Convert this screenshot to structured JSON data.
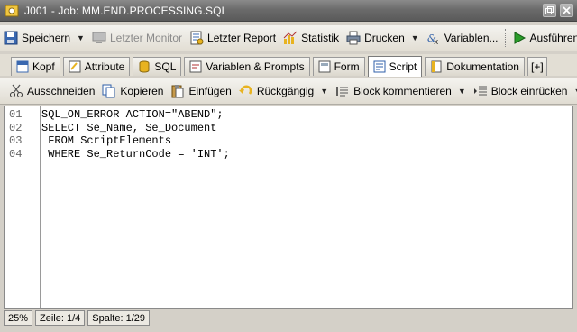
{
  "window": {
    "title": "J001 - Job: MM.END.PROCESSING.SQL"
  },
  "toolbar": {
    "speichern": "Speichern",
    "letzter_monitor": "Letzter Monitor",
    "letzter_report": "Letzter Report",
    "statistik": "Statistik",
    "drucken": "Drucken",
    "variablen": "Variablen...",
    "ausfuehren": "Ausführen"
  },
  "tabs": [
    {
      "label": "Kopf"
    },
    {
      "label": "Attribute"
    },
    {
      "label": "SQL"
    },
    {
      "label": "Variablen & Prompts"
    },
    {
      "label": "Form"
    },
    {
      "label": "Script",
      "active": true
    },
    {
      "label": "Dokumentation"
    },
    {
      "label": "[+]"
    }
  ],
  "edit_toolbar": {
    "ausschneiden": "Ausschneiden",
    "kopieren": "Kopieren",
    "einfuegen": "Einfügen",
    "rueckgaengig": "Rückgängig",
    "block_kommentieren": "Block kommentieren",
    "block_einruecken": "Block einrücken",
    "overflow": "»"
  },
  "editor": {
    "line_numbers": [
      "01",
      "02",
      "03",
      "04"
    ],
    "lines": [
      "SQL_ON_ERROR ACTION=\"ABEND\";",
      "SELECT Se_Name, Se_Document",
      " FROM ScriptElements",
      " WHERE Se_ReturnCode = 'INT';"
    ]
  },
  "status": {
    "zoom": "25%",
    "zeile": "Zeile: 1/4",
    "spalte": "Spalte: 1/29"
  },
  "icons": {
    "accent_green": "#2a9d2a",
    "accent_blue": "#2f5fa8",
    "accent_yellow": "#e8b320"
  }
}
